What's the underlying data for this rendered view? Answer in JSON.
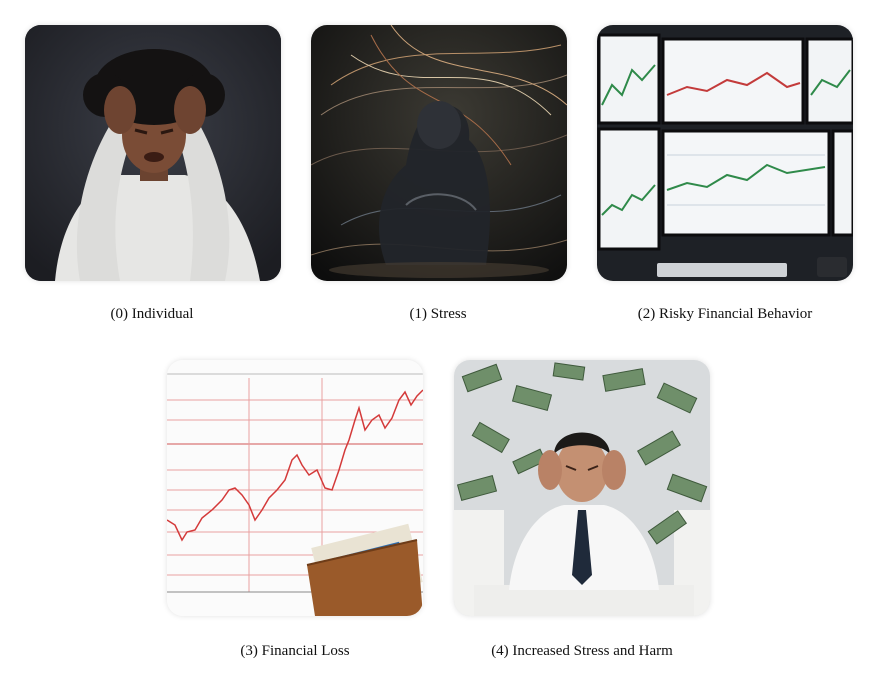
{
  "panels": [
    {
      "caption": "(0) Individual",
      "icon": "distressed-person"
    },
    {
      "caption": "(1) Stress",
      "icon": "abstract-stress-figure"
    },
    {
      "caption": "(2) Risky Financial Behavior",
      "icon": "trading-monitors"
    },
    {
      "caption": "(3) Financial Loss",
      "icon": "stock-chart-with-wallet"
    },
    {
      "caption": "(4) Increased Stress and Harm",
      "icon": "businessman-with-flying-money"
    }
  ],
  "colors": {
    "chart_line": "#d43a3a",
    "grid": "#e8a0a0",
    "wallet": "#9a5a2a",
    "money": "#6f8f6a",
    "background": "#ffffff"
  }
}
